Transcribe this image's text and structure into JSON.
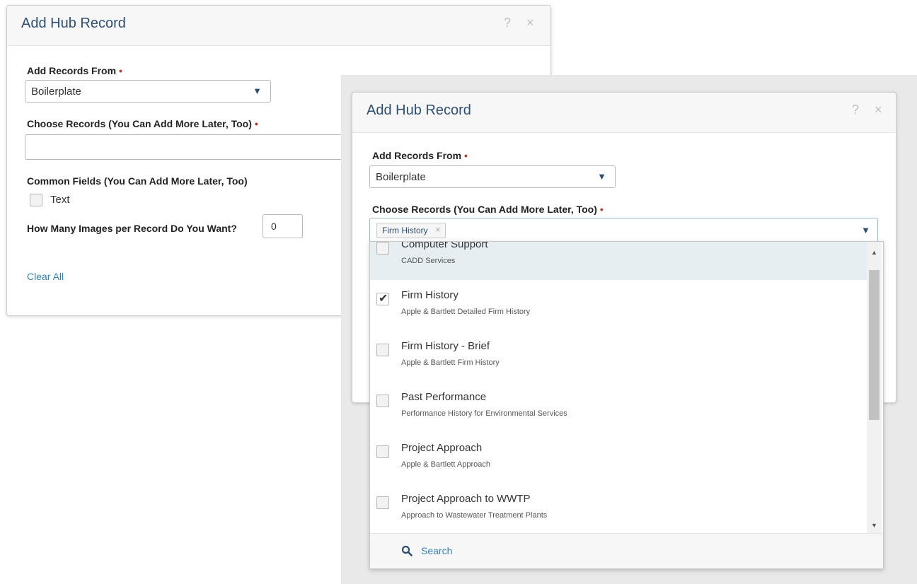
{
  "back_dialog": {
    "title": "Add Hub Record",
    "help_icon": "?",
    "close_icon": "×",
    "add_records_from_label": "Add Records From",
    "required_mark": "•",
    "source_select_value": "Boilerplate",
    "choose_records_label": "Choose Records (You Can Add More Later, Too)",
    "common_fields_label": "Common Fields (You Can Add More Later, Too)",
    "text_checkbox_label": "Text",
    "images_label": "How Many Images per Record Do You Want?",
    "images_value": "0",
    "clear_all": "Clear All"
  },
  "front_dialog": {
    "title": "Add Hub Record",
    "help_icon": "?",
    "close_icon": "×",
    "add_records_from_label": "Add Records From",
    "required_mark": "•",
    "source_select_value": "Boilerplate",
    "choose_records_label": "Choose Records (You Can Add More Later, Too)",
    "selected_tag": "Firm History",
    "tag_remove": "×"
  },
  "dropdown": {
    "options": [
      {
        "title": "Computer Support",
        "subtitle": "CADD Services",
        "checked": false
      },
      {
        "title": "Firm History",
        "subtitle": "Apple & Bartlett Detailed Firm History",
        "checked": true
      },
      {
        "title": "Firm History - Brief",
        "subtitle": "Apple & Bartlett Firm History",
        "checked": false
      },
      {
        "title": "Past Performance",
        "subtitle": "Performance History for Environmental Services",
        "checked": false
      },
      {
        "title": "Project Approach",
        "subtitle": "Apple & Bartlett Approach",
        "checked": false
      },
      {
        "title": "Project Approach to WWTP",
        "subtitle": "Approach to Wastewater Treatment Plants",
        "checked": false
      }
    ],
    "search_label": "Search"
  },
  "colors": {
    "title_blue": "#2f4f72",
    "link_blue": "#2f83b7",
    "required_red": "#c0392b",
    "hover_row": "#e6eef2"
  },
  "icons": {
    "help": "question-icon",
    "close": "close-icon",
    "dropdown": "triangle-down-icon",
    "search": "search-icon",
    "check": "check-icon"
  }
}
